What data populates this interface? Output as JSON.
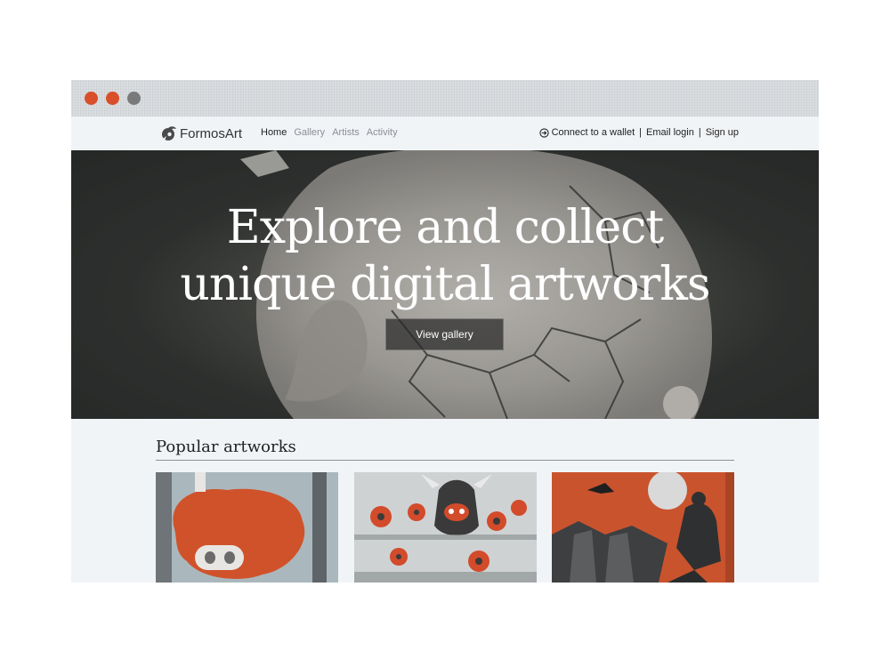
{
  "browser": {
    "controls": [
      "close",
      "minimize",
      "maximize"
    ],
    "colors": {
      "close": "#d94f2a",
      "minimize": "#d94f2a",
      "maximize": "#7a7a7a"
    }
  },
  "nav": {
    "brand": "FormosArt",
    "links": [
      {
        "label": "Home",
        "active": true
      },
      {
        "label": "Gallery",
        "active": false
      },
      {
        "label": "Artists",
        "active": false
      },
      {
        "label": "Activity",
        "active": false
      }
    ],
    "auth": {
      "connect_icon": "login-arrow-circle-icon",
      "connect": "Connect to a wallet",
      "separator": "|",
      "email": "Email login",
      "signup": "Sign up"
    }
  },
  "hero": {
    "title_line1": "Explore and collect",
    "title_line2": "unique digital artworks",
    "button": "View gallery"
  },
  "popular": {
    "title": "Popular artworks",
    "artworks": [
      {
        "description_icon": "orange-creature-artwork"
      },
      {
        "description_icon": "masked-crowd-artwork"
      },
      {
        "description_icon": "red-warrior-artwork"
      }
    ]
  },
  "colors": {
    "accent": "#d94f2a",
    "background": "#f1f4f7",
    "text": "#222222"
  }
}
